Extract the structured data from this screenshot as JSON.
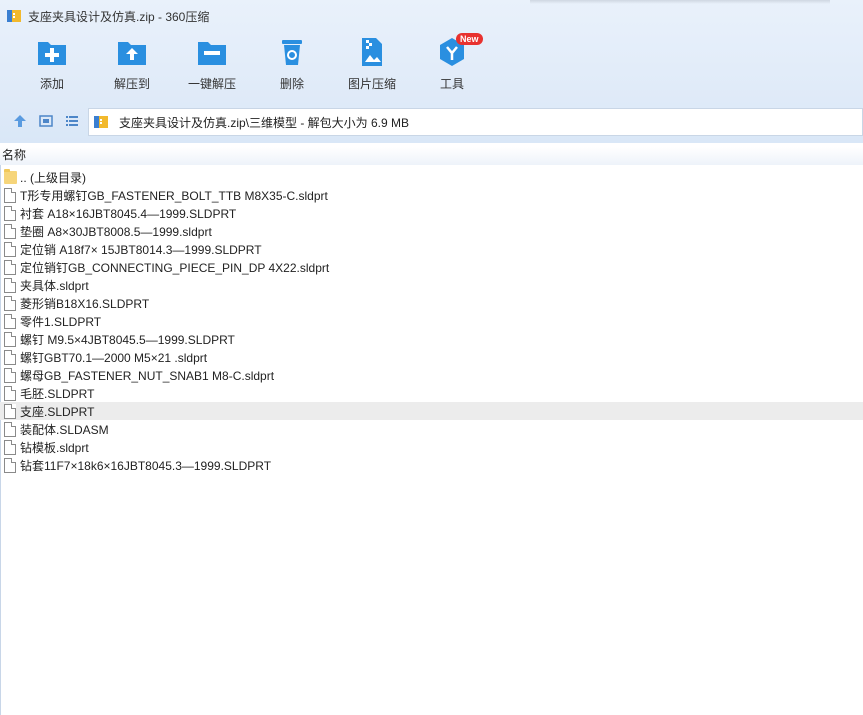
{
  "window": {
    "title": "支座夹具设计及仿真.zip - 360压缩"
  },
  "toolbar": {
    "items": [
      {
        "label": "添加",
        "icon": "add-folder-icon"
      },
      {
        "label": "解压到",
        "icon": "extract-to-icon"
      },
      {
        "label": "一键解压",
        "icon": "one-click-extract-icon"
      },
      {
        "label": "删除",
        "icon": "recycle-bin-icon"
      },
      {
        "label": "图片压缩",
        "icon": "image-compress-icon"
      },
      {
        "label": "工具",
        "icon": "tools-icon"
      }
    ],
    "badge": "New",
    "colors": {
      "icon_blue": "#2a8fe0",
      "badge_red": "#e8322f"
    }
  },
  "address": {
    "path": "支座夹具设计及仿真.zip\\三维模型 - 解包大小为 6.9 MB"
  },
  "list": {
    "column_name": "名称",
    "items": [
      {
        "name": ".. (上级目录)",
        "type": "folder"
      },
      {
        "name": "T形专用螺钉GB_FASTENER_BOLT_TTB M8X35-C.sldprt",
        "type": "file"
      },
      {
        "name": "衬套 A18×16JBT8045.4—1999.SLDPRT",
        "type": "file"
      },
      {
        "name": "垫圈 A8×30JBT8008.5—1999.sldprt",
        "type": "file"
      },
      {
        "name": "定位销 A18f7× 15JBT8014.3—1999.SLDPRT",
        "type": "file"
      },
      {
        "name": "定位销钉GB_CONNECTING_PIECE_PIN_DP 4X22.sldprt",
        "type": "file"
      },
      {
        "name": "夹具体.sldprt",
        "type": "file"
      },
      {
        "name": "菱形销B18X16.SLDPRT",
        "type": "file"
      },
      {
        "name": "零件1.SLDPRT",
        "type": "file"
      },
      {
        "name": "螺钉 M9.5×4JBT8045.5—1999.SLDPRT",
        "type": "file"
      },
      {
        "name": "螺钉GBT70.1—2000 M5×21 .sldprt",
        "type": "file"
      },
      {
        "name": "螺母GB_FASTENER_NUT_SNAB1 M8-C.sldprt",
        "type": "file"
      },
      {
        "name": "毛胚.SLDPRT",
        "type": "file"
      },
      {
        "name": "支座.SLDPRT",
        "type": "file",
        "selected": true
      },
      {
        "name": "装配体.SLDASM",
        "type": "file"
      },
      {
        "name": "钻模板.sldprt",
        "type": "file"
      },
      {
        "name": "钻套11F7×18k6×16JBT8045.3—1999.SLDPRT",
        "type": "file"
      }
    ]
  }
}
